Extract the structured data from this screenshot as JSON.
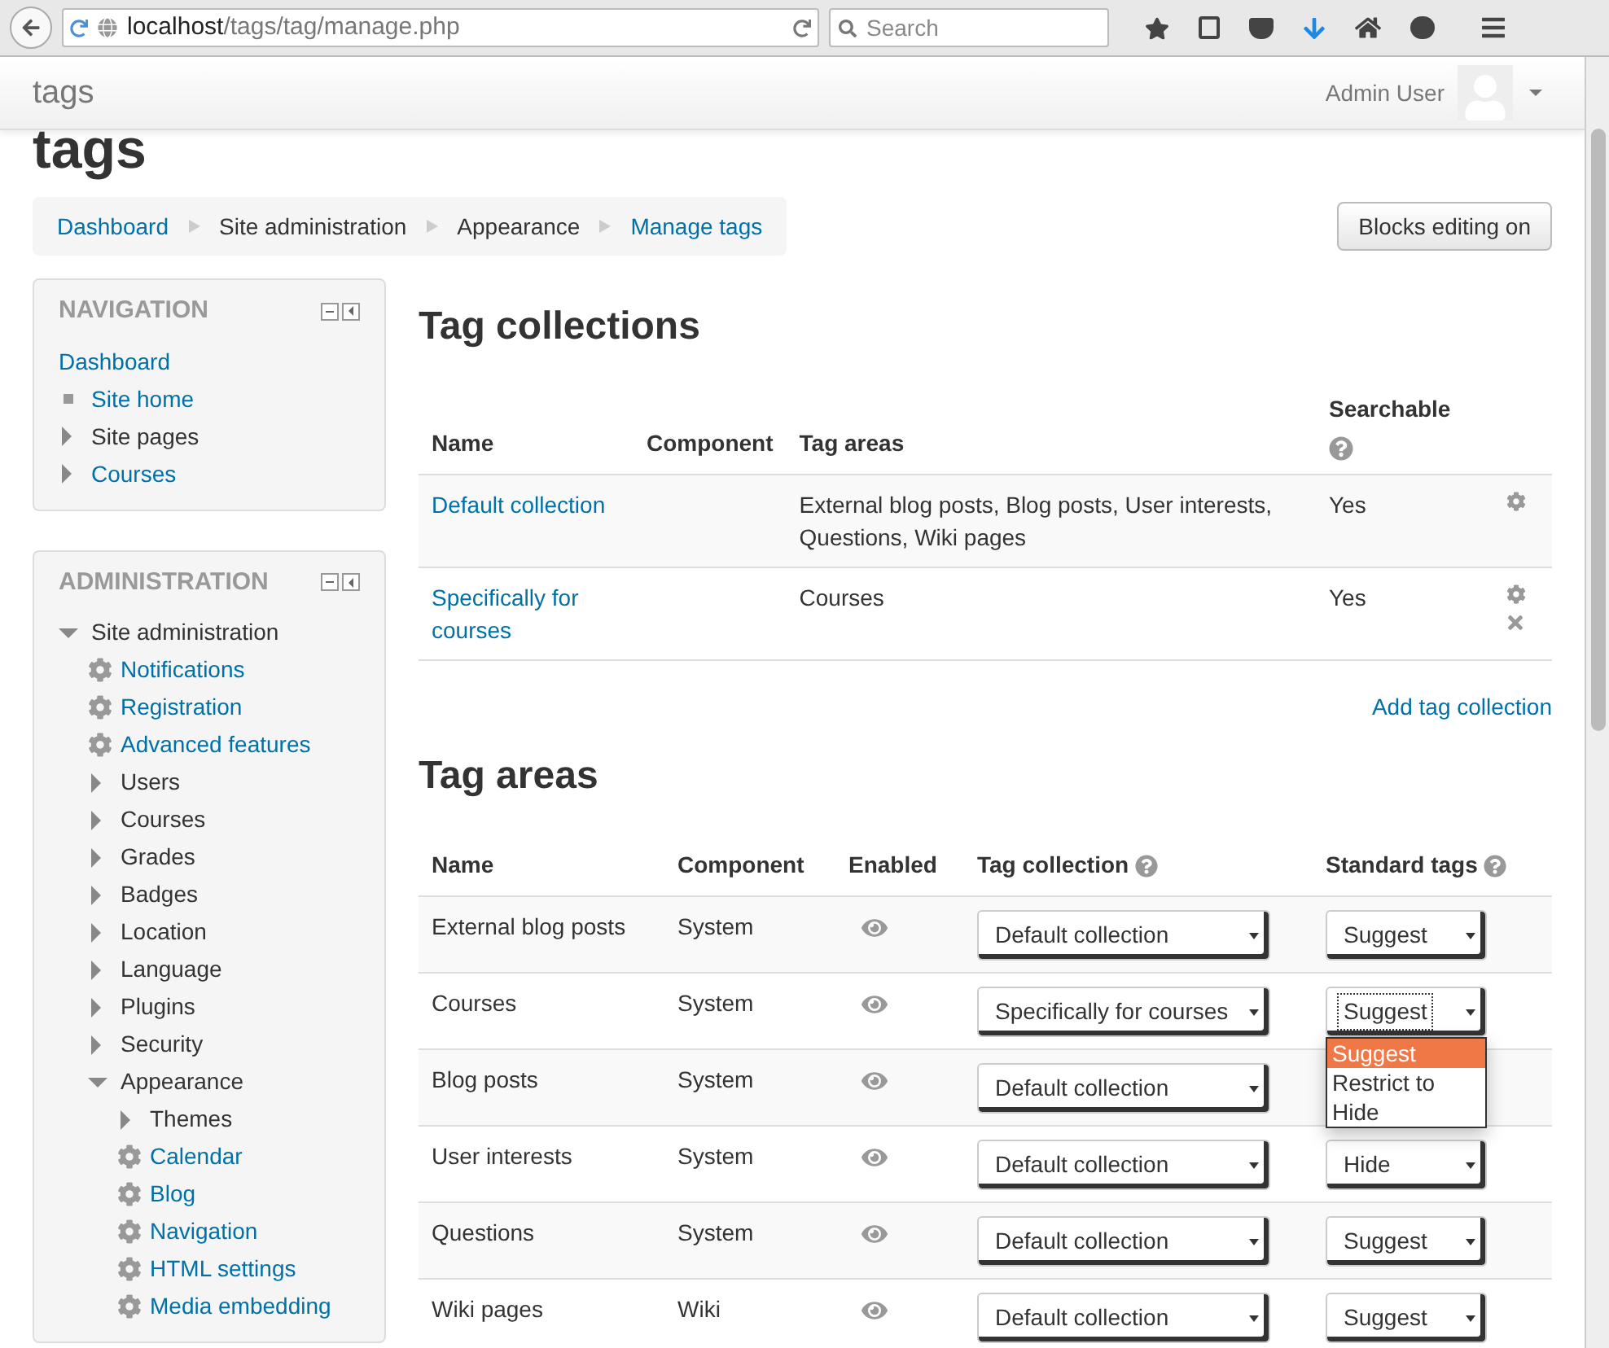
{
  "browser": {
    "url_host": "localhost",
    "url_path": "/tags/tag/manage.php",
    "search_placeholder": "Search"
  },
  "header": {
    "site_name": "tags",
    "user_name": "Admin User"
  },
  "page_title": "tags",
  "breadcrumb": [
    {
      "label": "Dashboard",
      "link": true
    },
    {
      "label": "Site administration",
      "link": false
    },
    {
      "label": "Appearance",
      "link": false
    },
    {
      "label": "Manage tags",
      "link": true
    }
  ],
  "blocks_button": "Blocks editing on",
  "navigation": {
    "title": "NAVIGATION",
    "items": [
      {
        "label": "Dashboard",
        "kind": "top",
        "link": true
      },
      {
        "label": "Site home",
        "kind": "leaf",
        "link": true
      },
      {
        "label": "Site pages",
        "kind": "branch",
        "link": false,
        "expanded": false
      },
      {
        "label": "Courses",
        "kind": "branch",
        "link": true,
        "expanded": false
      }
    ]
  },
  "administration": {
    "title": "ADMINISTRATION",
    "items": [
      {
        "label": "Site administration",
        "kind": "branch",
        "link": false,
        "expanded": true,
        "children": [
          {
            "label": "Notifications",
            "kind": "setting",
            "link": true
          },
          {
            "label": "Registration",
            "kind": "setting",
            "link": true
          },
          {
            "label": "Advanced features",
            "kind": "setting",
            "link": true
          },
          {
            "label": "Users",
            "kind": "branch",
            "link": false,
            "expanded": false
          },
          {
            "label": "Courses",
            "kind": "branch",
            "link": false,
            "expanded": false
          },
          {
            "label": "Grades",
            "kind": "branch",
            "link": false,
            "expanded": false
          },
          {
            "label": "Badges",
            "kind": "branch",
            "link": false,
            "expanded": false
          },
          {
            "label": "Location",
            "kind": "branch",
            "link": false,
            "expanded": false
          },
          {
            "label": "Language",
            "kind": "branch",
            "link": false,
            "expanded": false
          },
          {
            "label": "Plugins",
            "kind": "branch",
            "link": false,
            "expanded": false
          },
          {
            "label": "Security",
            "kind": "branch",
            "link": false,
            "expanded": false
          },
          {
            "label": "Appearance",
            "kind": "branch",
            "link": false,
            "expanded": true,
            "children": [
              {
                "label": "Themes",
                "kind": "branch",
                "link": false,
                "expanded": false
              },
              {
                "label": "Calendar",
                "kind": "setting",
                "link": true
              },
              {
                "label": "Blog",
                "kind": "setting",
                "link": true
              },
              {
                "label": "Navigation",
                "kind": "setting",
                "link": true
              },
              {
                "label": "HTML settings",
                "kind": "setting",
                "link": true
              },
              {
                "label": "Media embedding",
                "kind": "setting",
                "link": true
              }
            ]
          }
        ]
      }
    ]
  },
  "tag_collections": {
    "heading": "Tag collections",
    "columns": [
      "Name",
      "Component",
      "Tag areas",
      "Searchable"
    ],
    "rows": [
      {
        "name": "Default collection",
        "component": "",
        "tag_areas": "External blog posts, Blog posts, User interests, Questions, Wiki pages",
        "searchable": "Yes",
        "deletable": false
      },
      {
        "name": "Specifically for courses",
        "component": "",
        "tag_areas": "Courses",
        "searchable": "Yes",
        "deletable": true
      }
    ],
    "add_link": "Add tag collection"
  },
  "tag_areas": {
    "heading": "Tag areas",
    "columns": [
      "Name",
      "Component",
      "Enabled",
      "Tag collection",
      "Standard tags"
    ],
    "rows": [
      {
        "name": "External blog posts",
        "component": "System",
        "enabled": true,
        "collection": "Default collection",
        "standard": "Suggest"
      },
      {
        "name": "Courses",
        "component": "System",
        "enabled": true,
        "collection": "Specifically for courses",
        "standard": "Suggest",
        "open": true,
        "options": [
          {
            "label": "Suggest",
            "selected": true
          },
          {
            "label": "Restrict to",
            "selected": false
          },
          {
            "label": "Hide",
            "selected": false
          }
        ]
      },
      {
        "name": "Blog posts",
        "component": "System",
        "enabled": true,
        "collection": "Default collection"
      },
      {
        "name": "User interests",
        "component": "System",
        "enabled": true,
        "collection": "Default collection",
        "standard": "Hide"
      },
      {
        "name": "Questions",
        "component": "System",
        "enabled": true,
        "collection": "Default collection",
        "standard": "Suggest"
      },
      {
        "name": "Wiki pages",
        "component": "Wiki",
        "enabled": true,
        "collection": "Default collection",
        "standard": "Suggest"
      }
    ]
  }
}
